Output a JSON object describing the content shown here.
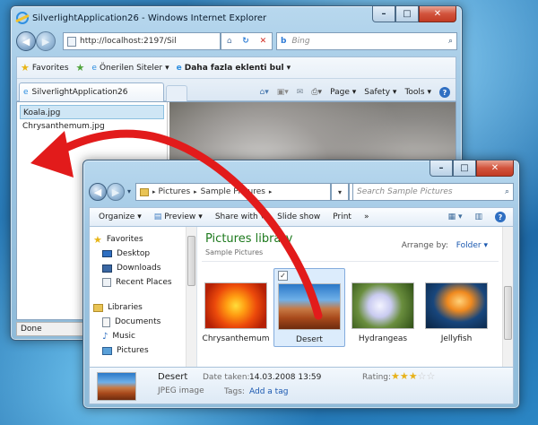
{
  "ie": {
    "title": "SilverlightApplication26 - Windows Internet Explorer",
    "address": "http://localhost:2197/Sil",
    "search_placeholder": "Bing",
    "favorites_label": "Favorites",
    "suggested_sites": "Önerilen Siteler",
    "more_addons": "Daha fazla eklenti bul",
    "tab_title": "SilverlightApplication26",
    "commands": {
      "page": "Page",
      "safety": "Safety",
      "tools": "Tools"
    },
    "files": [
      "Koala.jpg",
      "Chrysanthemum.jpg"
    ],
    "status": "Done"
  },
  "explorer": {
    "breadcrumb": [
      "Pictures",
      "Sample Pictures"
    ],
    "search_placeholder": "Search Sample Pictures",
    "toolbar": {
      "organize": "Organize",
      "preview": "Preview",
      "share_with": "Share with",
      "slide_show": "Slide show",
      "print": "Print",
      "more": "»"
    },
    "nav": {
      "favorites": "Favorites",
      "favorites_items": [
        "Desktop",
        "Downloads",
        "Recent Places"
      ],
      "libraries": "Libraries",
      "libraries_items": [
        "Documents",
        "Music",
        "Pictures"
      ]
    },
    "library_title": "Pictures library",
    "library_subtitle": "Sample Pictures",
    "arrange_by_label": "Arrange by:",
    "arrange_by_value": "Folder",
    "thumbnails": [
      "Chrysanthemum",
      "Desert",
      "Hydrangeas",
      "Jellyfish"
    ],
    "details": {
      "name": "Desert",
      "type": "JPEG image",
      "date_label": "Date taken:",
      "date_value": "14.03.2008 13:59",
      "tags_label": "Tags:",
      "tags_value": "Add a tag",
      "rating_label": "Rating:",
      "rating": 3
    }
  },
  "colors": {
    "desktop": "#2374b2",
    "library_title": "#1e7a1e",
    "drag_arrow": "#e21b1b"
  }
}
